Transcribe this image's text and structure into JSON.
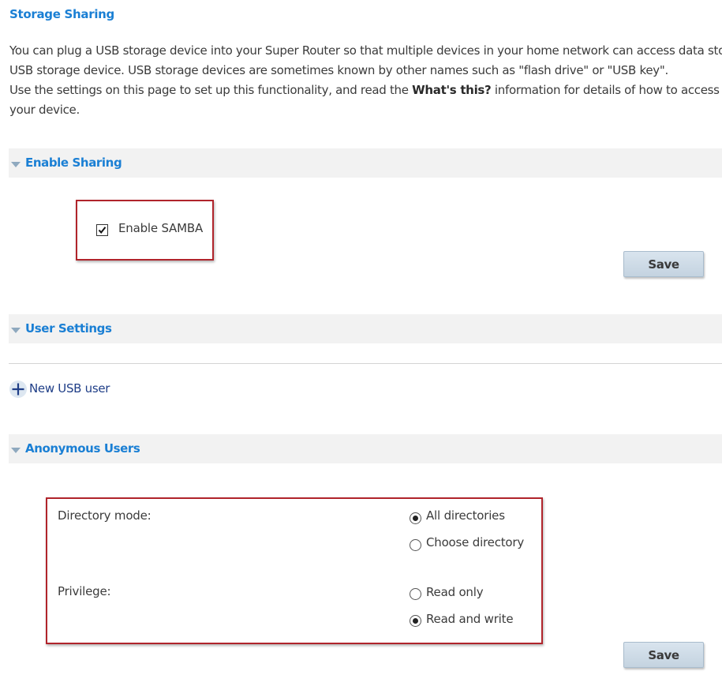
{
  "page": {
    "title": "Storage Sharing",
    "intro_line1": "You can plug a USB storage device into your Super Router so that multiple devices in your home network can access data sto",
    "intro_line2": "USB storage device. USB storage devices are sometimes known by other names such as \"flash drive\" or \"USB key\".",
    "intro_line3_before": "Use the settings on this page to set up this functionality, and read the ",
    "intro_line3_bold": "What's this?",
    "intro_line3_after": " information for details of how to access t",
    "intro_line4": "your device."
  },
  "enable_sharing": {
    "header": "Enable Sharing",
    "checkbox_label": "Enable SAMBA",
    "checked": true,
    "save_label": "Save"
  },
  "user_settings": {
    "header": "User Settings",
    "new_user_label": "New USB user"
  },
  "anonymous_users": {
    "header": "Anonymous Users",
    "directory_mode_label": "Directory mode:",
    "directory_options": [
      "All directories",
      "Choose directory"
    ],
    "directory_selected": "All directories",
    "privilege_label": "Privilege:",
    "privilege_options": [
      "Read only",
      "Read and write"
    ],
    "privilege_selected": "Read and write",
    "save_label": "Save"
  },
  "colors": {
    "accent_blue": "#1a7fd4",
    "highlight_red": "#b0242b",
    "link_navy": "#1f3e87"
  }
}
